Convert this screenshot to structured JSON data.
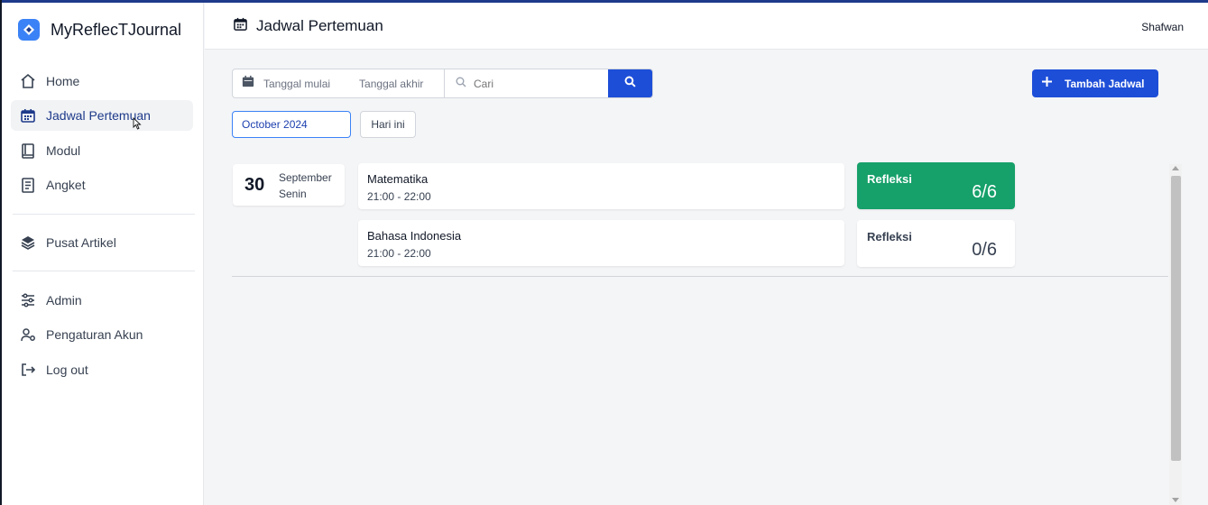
{
  "app": {
    "name": "MyReflecTJournal"
  },
  "sidebar": {
    "items": [
      {
        "label": "Home",
        "icon": "home-icon"
      },
      {
        "label": "Jadwal Pertemuan",
        "icon": "calendar-icon",
        "active": true
      },
      {
        "label": "Modul",
        "icon": "book-icon"
      },
      {
        "label": "Angket",
        "icon": "survey-icon"
      },
      {
        "label": "Pusat Artikel",
        "icon": "layers-icon"
      },
      {
        "label": "Admin",
        "icon": "sliders-icon"
      },
      {
        "label": "Pengaturan Akun",
        "icon": "user-settings-icon"
      },
      {
        "label": "Log out",
        "icon": "logout-icon"
      }
    ]
  },
  "header": {
    "title": "Jadwal Pertemuan",
    "user": "Shafwan"
  },
  "filter": {
    "start_placeholder": "Tanggal mulai",
    "end_placeholder": "Tanggal akhir",
    "search_placeholder": "Cari"
  },
  "actions": {
    "add_label": "Tambah Jadwal"
  },
  "period": {
    "month": "October 2024",
    "today": "Hari ini"
  },
  "schedule": {
    "date": {
      "day": "30",
      "month": "September",
      "weekday": "Senin"
    },
    "lessons": [
      {
        "subject": "Matematika",
        "time": "21:00 - 22:00",
        "reflection_label": "Refleksi",
        "reflection_count": "6/6",
        "complete": true
      },
      {
        "subject": "Bahasa Indonesia",
        "time": "21:00 - 22:00",
        "reflection_label": "Refleksi",
        "reflection_count": "0/6",
        "complete": false
      }
    ]
  },
  "colors": {
    "primary": "#1d4ed8",
    "success": "#16a06a",
    "brand": "#3b82f6"
  }
}
